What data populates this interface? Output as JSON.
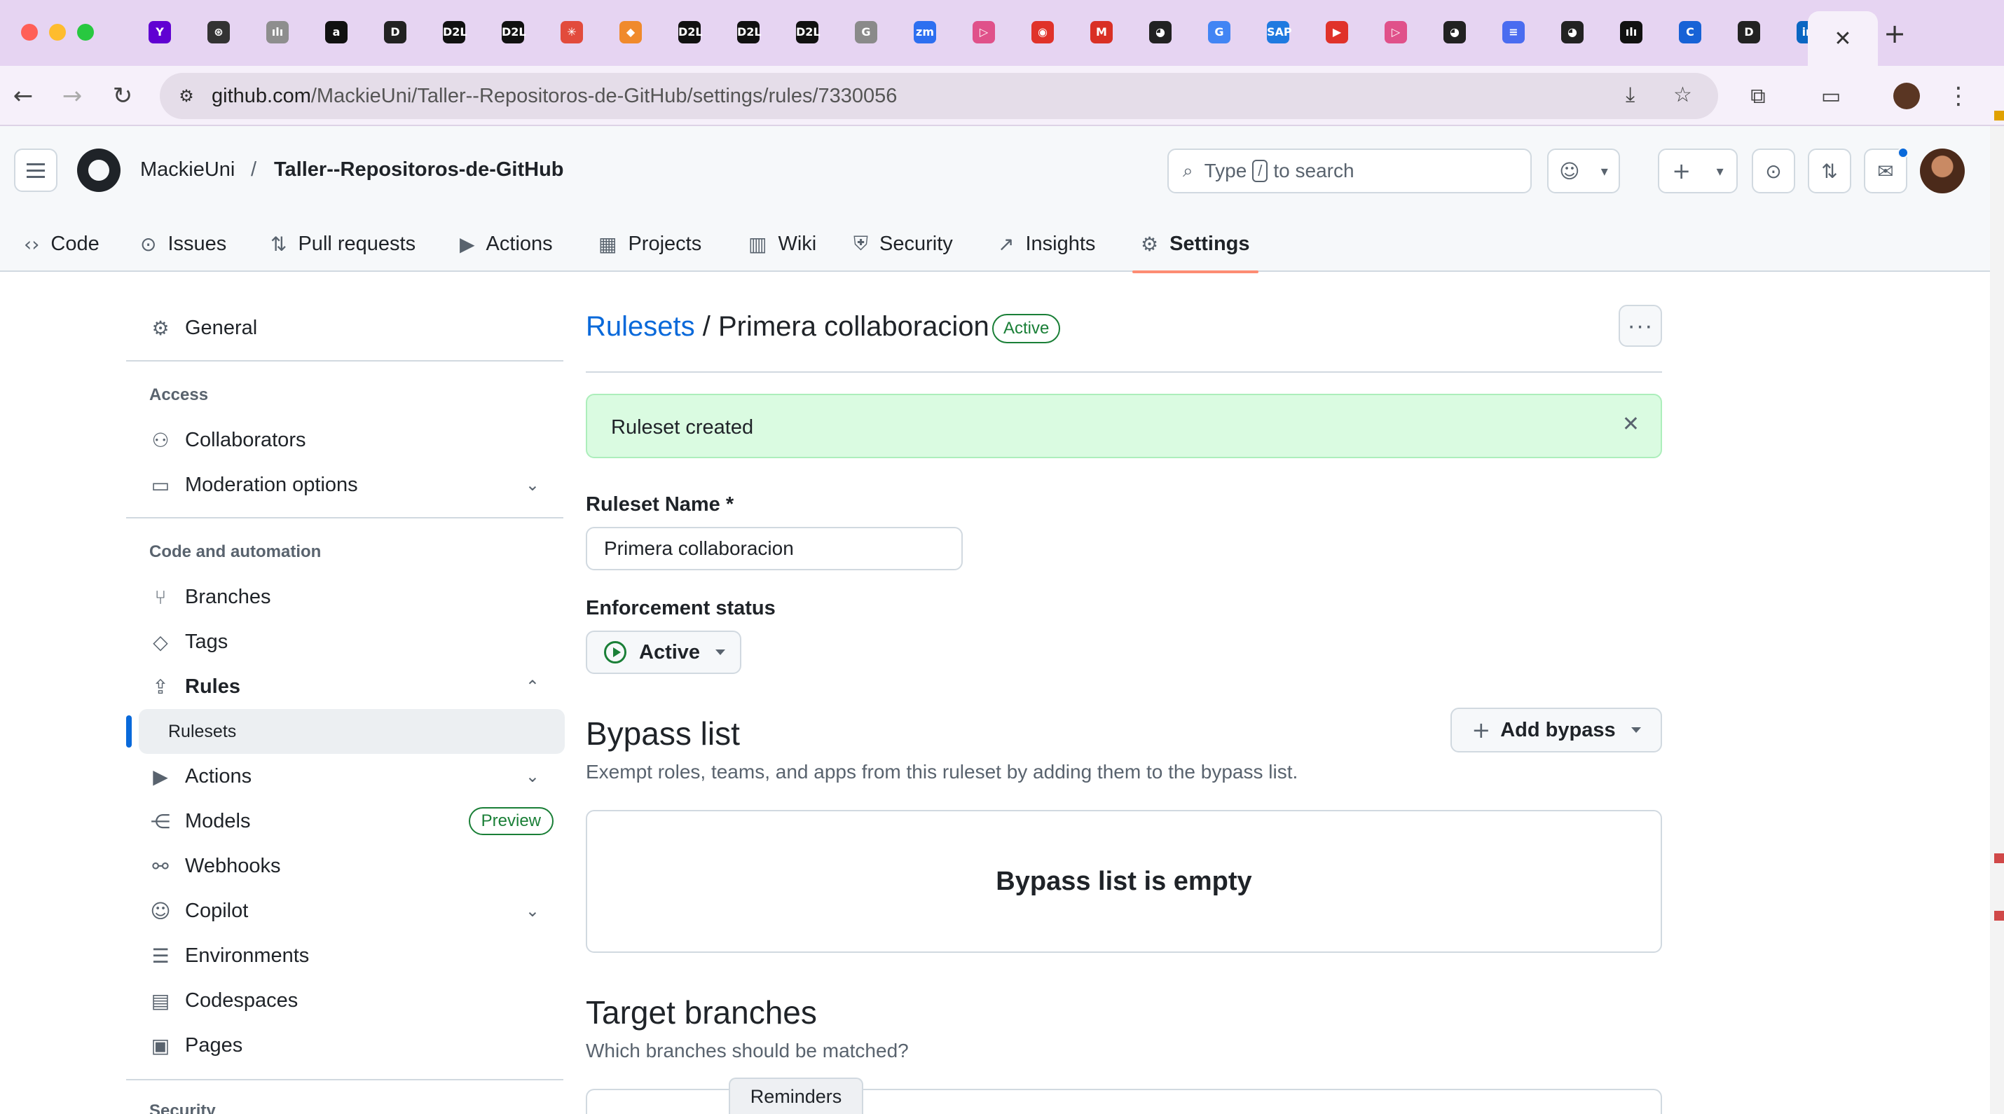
{
  "browser": {
    "colors": {
      "tab_strip": "#e6d4f2",
      "toolbar": "#f6f0fa"
    },
    "traffic_lights": [
      "#ff5f57",
      "#febc2e",
      "#28c840"
    ],
    "tab_favicons": [
      {
        "icon": "yahoo-icon",
        "glyph": "Y",
        "color": "#6001d2"
      },
      {
        "icon": "openai-icon",
        "glyph": "⊛",
        "color": "#333333"
      },
      {
        "icon": "chart-icon",
        "glyph": "ılı",
        "color": "#8e8e8e"
      },
      {
        "icon": "amazon-icon",
        "glyph": "a",
        "color": "#111111"
      },
      {
        "icon": "d2l-round-icon",
        "glyph": "D",
        "color": "#222222"
      },
      {
        "icon": "d2l-icon",
        "glyph": "D2L",
        "color": "#111111"
      },
      {
        "icon": "d2l-icon",
        "glyph": "D2L",
        "color": "#111111"
      },
      {
        "icon": "asterisk-icon",
        "glyph": "✳",
        "color": "#e24b3c"
      },
      {
        "icon": "box-icon",
        "glyph": "◆",
        "color": "#f08a2c"
      },
      {
        "icon": "d2l-icon",
        "glyph": "D2L",
        "color": "#111111"
      },
      {
        "icon": "d2l-icon",
        "glyph": "D2L",
        "color": "#111111"
      },
      {
        "icon": "d2l-icon",
        "glyph": "D2L",
        "color": "#111111"
      },
      {
        "icon": "grammarly-icon",
        "glyph": "G",
        "color": "#8a8a8a"
      },
      {
        "icon": "zoom-icon",
        "glyph": "zm",
        "color": "#2d6ff0"
      },
      {
        "icon": "play-icon",
        "glyph": "▷",
        "color": "#e0518a"
      },
      {
        "icon": "record-icon",
        "glyph": "◉",
        "color": "#e0322a"
      },
      {
        "icon": "gmail-icon",
        "glyph": "M",
        "color": "#d93025"
      },
      {
        "icon": "github-icon",
        "glyph": "◕",
        "color": "#222222"
      },
      {
        "icon": "google-icon",
        "glyph": "G",
        "color": "#4285f4"
      },
      {
        "icon": "sap-icon",
        "glyph": "SAP",
        "color": "#1f7ae0"
      },
      {
        "icon": "youtube-icon",
        "glyph": "▶",
        "color": "#e0322a"
      },
      {
        "icon": "play-icon",
        "glyph": "▷",
        "color": "#e0518a"
      },
      {
        "icon": "github-icon",
        "glyph": "◕",
        "color": "#222222"
      },
      {
        "icon": "docs-icon",
        "glyph": "≡",
        "color": "#4a6cf0"
      },
      {
        "icon": "github-icon",
        "glyph": "◕",
        "color": "#222222"
      },
      {
        "icon": "bars-icon",
        "glyph": "ılı",
        "color": "#111111"
      },
      {
        "icon": "c-icon",
        "glyph": "C",
        "color": "#1762d6"
      },
      {
        "icon": "d2l-round-icon",
        "glyph": "D",
        "color": "#222222"
      },
      {
        "icon": "linkedin-icon",
        "glyph": "in",
        "color": "#0a66c2"
      }
    ],
    "active_tab_close": "✕",
    "new_tab": "+",
    "url_host": "github.com",
    "url_path": "/MackieUni/Taller--Repositoros-de-GitHub/settings/rules/7330056"
  },
  "header": {
    "owner": "MackieUni",
    "separator": "/",
    "repo": "Taller--Repositoros-de-GitHub",
    "search_prefix": "Type",
    "search_key": "/",
    "search_suffix": "to search"
  },
  "repo_nav": [
    {
      "label": "Code",
      "icon": "code-icon",
      "glyph": "‹›"
    },
    {
      "label": "Issues",
      "icon": "issue-icon",
      "glyph": "⊙"
    },
    {
      "label": "Pull requests",
      "icon": "pull-request-icon",
      "glyph": "⇅"
    },
    {
      "label": "Actions",
      "icon": "play-circle-icon",
      "glyph": "▶"
    },
    {
      "label": "Projects",
      "icon": "table-icon",
      "glyph": "▦"
    },
    {
      "label": "Wiki",
      "icon": "book-icon",
      "glyph": "▥"
    },
    {
      "label": "Security",
      "icon": "shield-icon",
      "glyph": "⛨"
    },
    {
      "label": "Insights",
      "icon": "graph-icon",
      "glyph": "↗"
    },
    {
      "label": "Settings",
      "icon": "gear-icon",
      "glyph": "⚙",
      "selected": true
    }
  ],
  "sidebar": {
    "general": "General",
    "access_heading": "Access",
    "collaborators": "Collaborators",
    "moderation": "Moderation options",
    "code_heading": "Code and automation",
    "branches": "Branches",
    "tags": "Tags",
    "rules": "Rules",
    "rulesets": "Rulesets",
    "actions": "Actions",
    "models": "Models",
    "models_badge": "Preview",
    "webhooks": "Webhooks",
    "copilot": "Copilot",
    "environments": "Environments",
    "codespaces": "Codespaces",
    "pages": "Pages",
    "security_heading": "Security"
  },
  "main": {
    "breadcrumb_link": "Rulesets",
    "breadcrumb_sep": " / ",
    "ruleset_title": "Primera collaboracion",
    "state_badge": "Active",
    "flash": "Ruleset created",
    "name_label": "Ruleset Name *",
    "name_value": "Primera collaboracion",
    "enforcement_label": "Enforcement status",
    "enforcement_value": "Active",
    "bypass_title": "Bypass list",
    "bypass_desc": "Exempt roles, teams, and apps from this ruleset by adding them to the bypass list.",
    "add_bypass": "Add bypass",
    "bypass_empty": "Bypass list is empty",
    "target_title": "Target branches",
    "target_desc": "Which branches should be matched?"
  },
  "reminders": "Reminders"
}
